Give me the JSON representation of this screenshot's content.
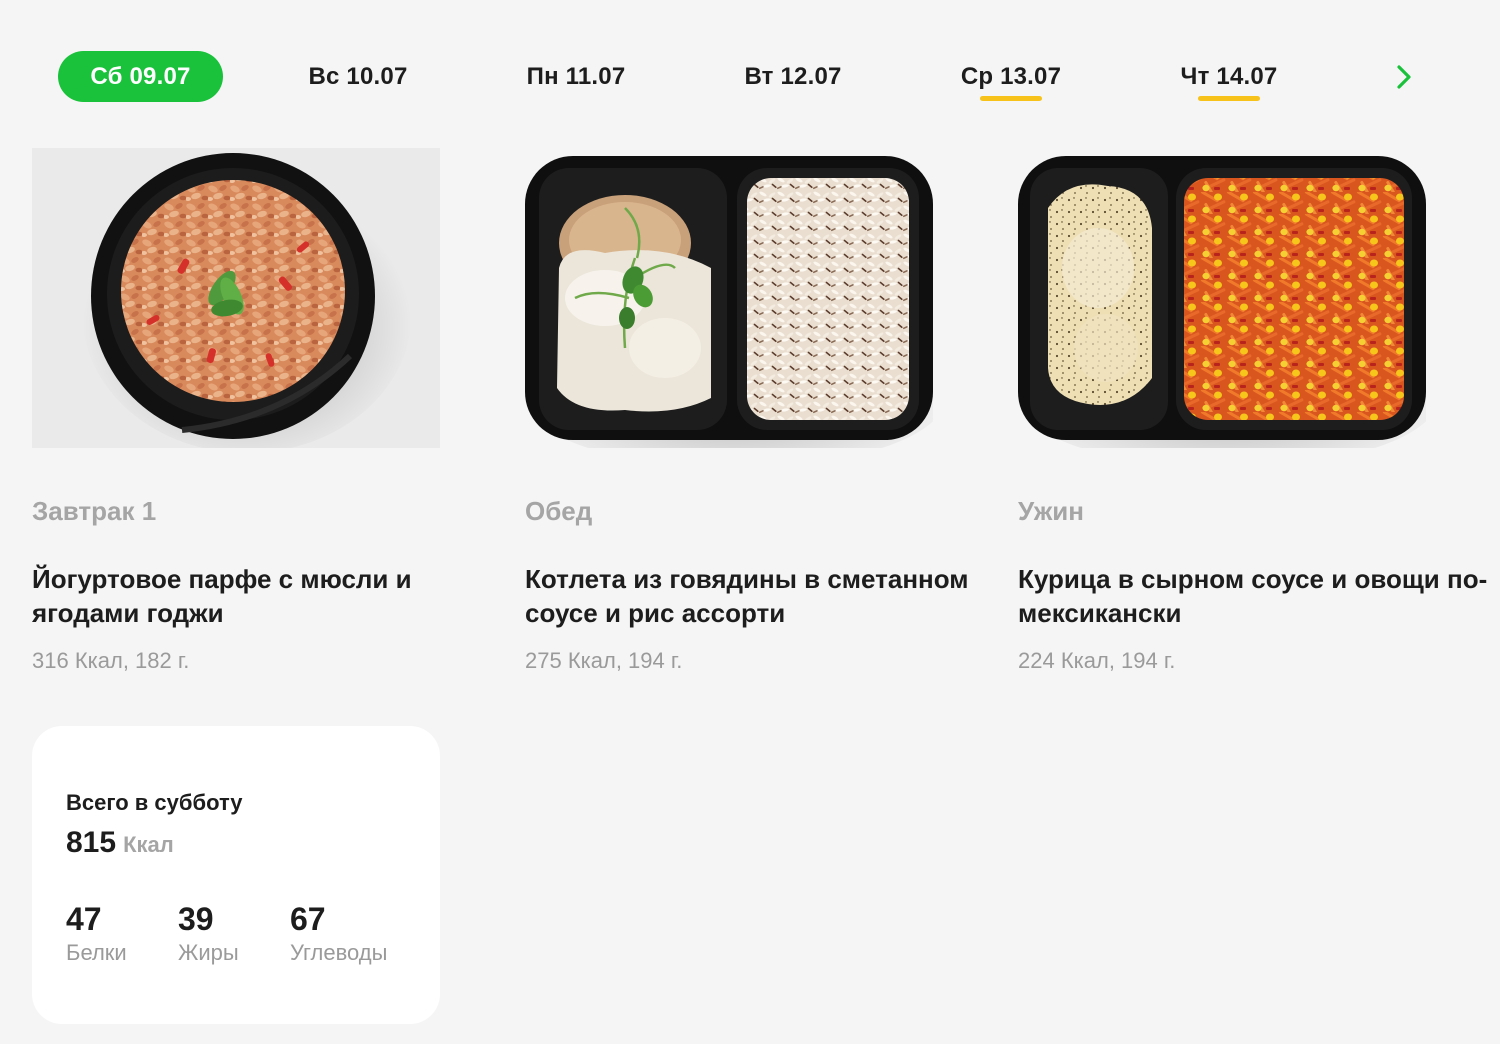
{
  "days": [
    {
      "label": "Сб 09.07",
      "active": true,
      "marked": false
    },
    {
      "label": "Вс 10.07",
      "active": false,
      "marked": false
    },
    {
      "label": "Пн 11.07",
      "active": false,
      "marked": false
    },
    {
      "label": "Вт 12.07",
      "active": false,
      "marked": false
    },
    {
      "label": "Ср 13.07",
      "active": false,
      "marked": true
    },
    {
      "label": "Чт 14.07",
      "active": false,
      "marked": true
    }
  ],
  "next_icon": "chevron-right-icon",
  "meals": [
    {
      "type": "Завтрак 1",
      "name": "Йогуртовое парфе с мюсли и ягодами годжи",
      "info": "316 Ккал, 182 г.",
      "photo": "granola-bowl-photo"
    },
    {
      "type": "Обед",
      "name": "Котлета из говядины в сметанном соусе и рис ассорти",
      "info": "275 Ккал, 194 г.",
      "photo": "cutlet-rice-container-photo"
    },
    {
      "type": "Ужин",
      "name": "Курица в сырном соусе и овощи по-мексикански",
      "info": "224 Ккал, 194 г.",
      "photo": "chicken-vegetables-container-photo"
    }
  ],
  "totals": {
    "title": "Всего в субботу",
    "kcal": "815",
    "kcal_unit": "Ккал",
    "macros": [
      {
        "value": "47",
        "label": "Белки"
      },
      {
        "value": "39",
        "label": "Жиры"
      },
      {
        "value": "67",
        "label": "Углеводы"
      }
    ]
  },
  "colors": {
    "accent_green": "#19c23a",
    "marker_yellow": "#f7c21a",
    "background": "#f5f5f5",
    "muted_text": "#9a9a9a"
  }
}
